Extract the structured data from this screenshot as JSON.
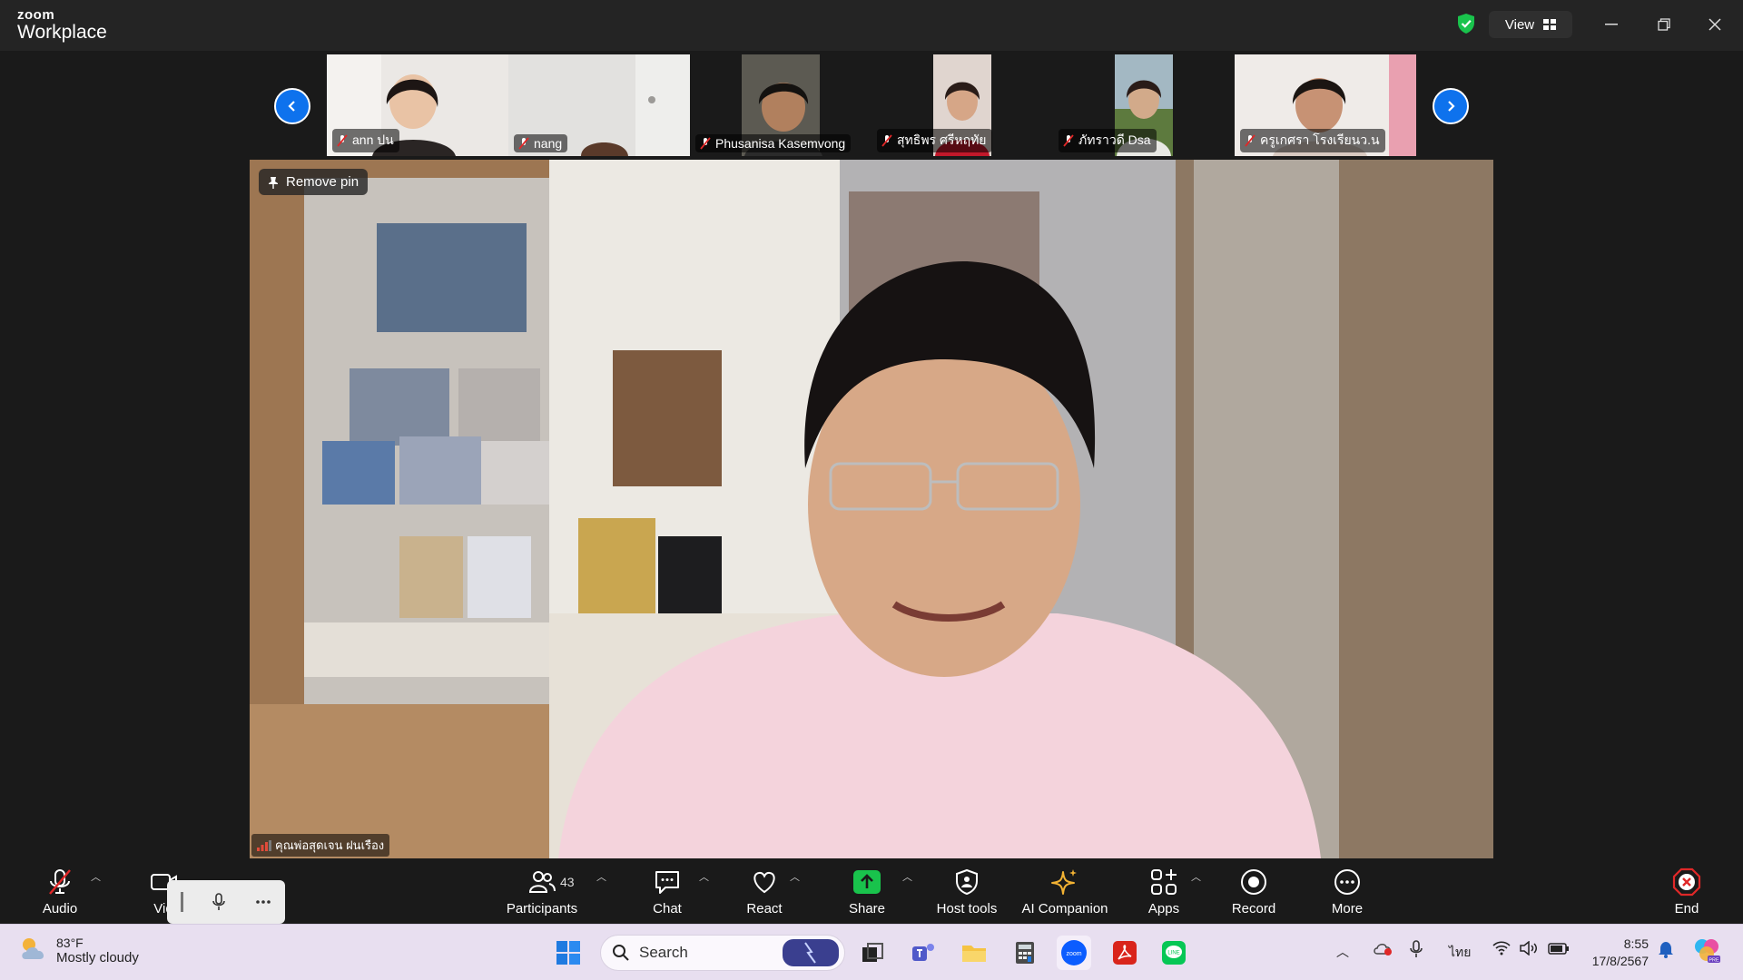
{
  "app": {
    "logo_top": "zoom",
    "logo_bottom": "Workplace",
    "view_label": "View"
  },
  "gallery": {
    "participants": [
      {
        "name": "ann ปน",
        "bg": "#e7e4e1"
      },
      {
        "name": "nang",
        "bg": "#dcdbd9"
      },
      {
        "name": "Phusanisa Kasemvong",
        "bg": "#3a3a36"
      },
      {
        "name": "สุทธิพร ศรีหฤทัย",
        "bg": "#d6c9c2"
      },
      {
        "name": "ภัทราวดี Dsa",
        "bg": "#8aa7b8"
      },
      {
        "name": "ครูเกศรา โรงเรียนว.น",
        "bg": "#efe9e6"
      }
    ]
  },
  "main": {
    "remove_pin_label": "Remove pin",
    "speaker_name": "คุณพ่อสุดเจน ฝนเรือง"
  },
  "toolbar": {
    "audio": "Audio",
    "video": "Vid",
    "participants": "Participants",
    "participant_count": "43",
    "chat": "Chat",
    "react": "React",
    "share": "Share",
    "host_tools": "Host tools",
    "ai_companion": "AI Companion",
    "apps": "Apps",
    "record": "Record",
    "more": "More",
    "end": "End",
    "share_color": "#19c34c",
    "end_color": "#e02828"
  },
  "taskbar": {
    "temperature": "83°F",
    "condition": "Mostly cloudy",
    "search_placeholder": "Search",
    "language": "ไทย",
    "time": "8:55",
    "date": "17/8/2567"
  }
}
